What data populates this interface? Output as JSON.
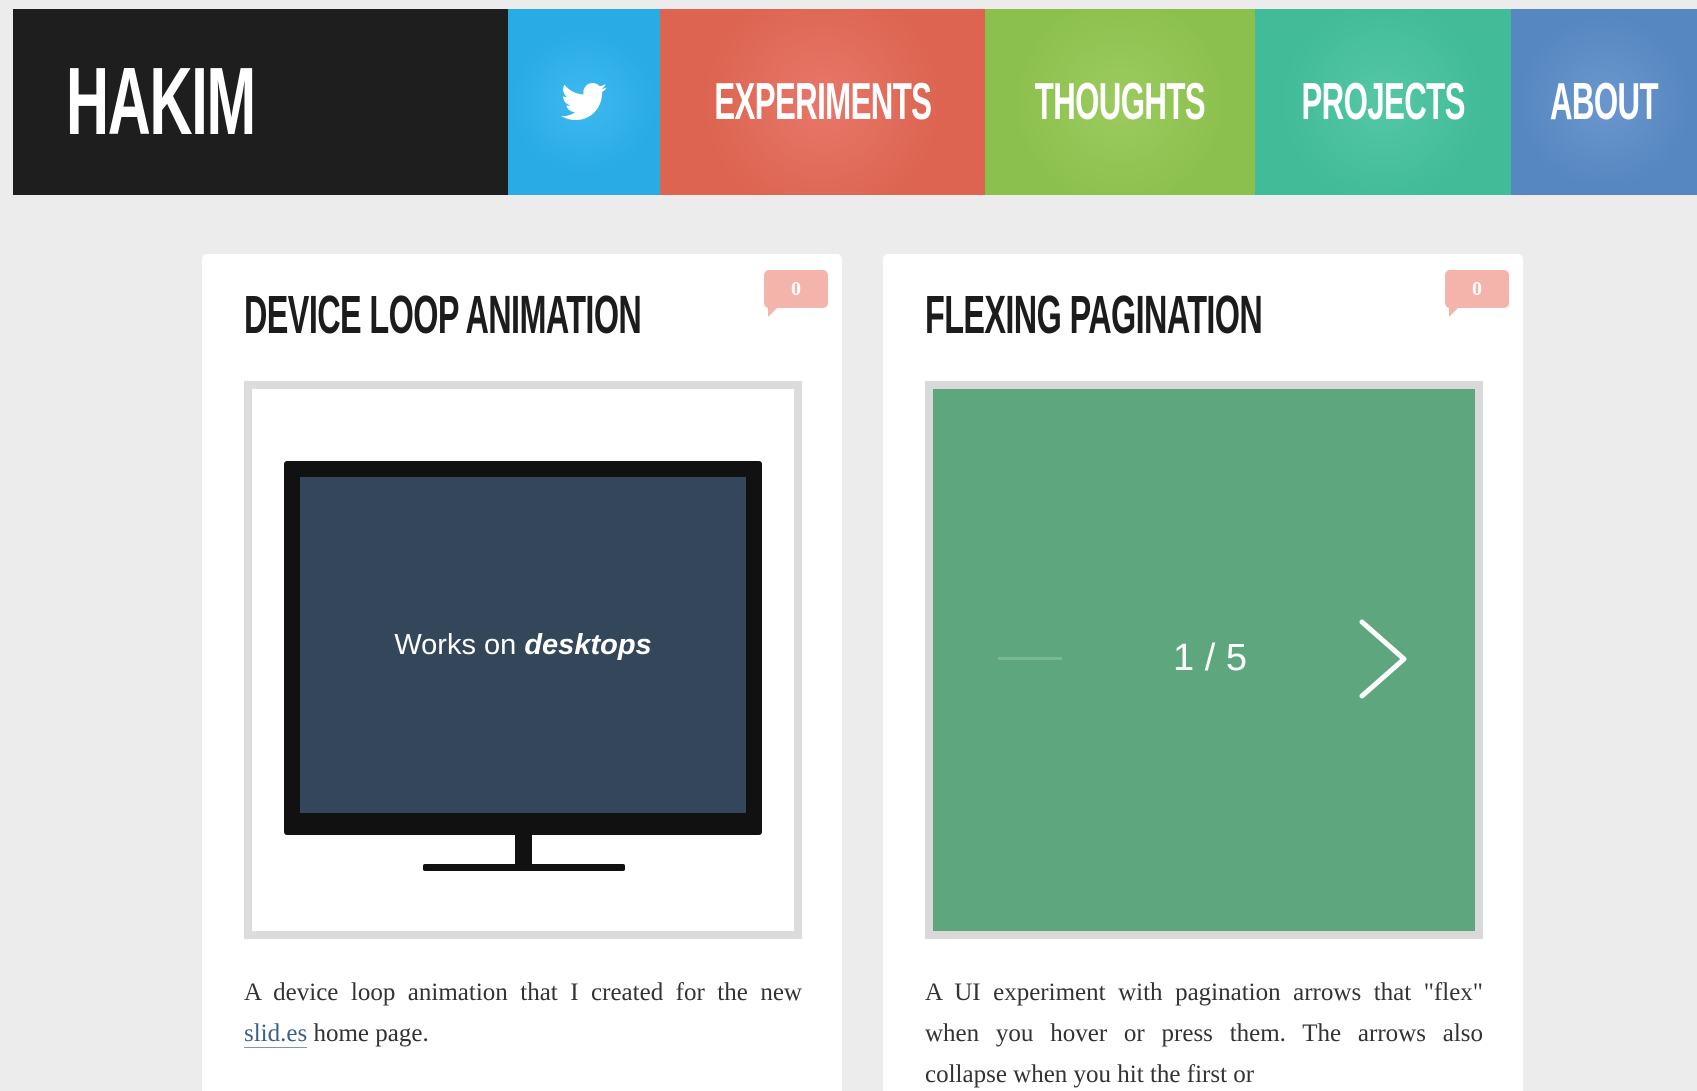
{
  "header": {
    "logo": "HAKIM",
    "nav": [
      {
        "label": "",
        "icon": "twitter-icon",
        "color": "#29abe6"
      },
      {
        "label": "EXPERIMENTS",
        "color": "#e0634f"
      },
      {
        "label": "THOUGHTS",
        "color": "#8ec14f"
      },
      {
        "label": "PROJECTS",
        "color": "#43bc9a"
      },
      {
        "label": "ABOUT",
        "color": "#5a88c2"
      }
    ]
  },
  "cards": [
    {
      "title": "DEVICE LOOP ANIMATION",
      "comments": "0",
      "preview_text": "Works on",
      "preview_text_emphasis": "desktops",
      "description_before": "A device loop animation that I created for the new",
      "description_link": "slid.es",
      "description_after": "home page."
    },
    {
      "title": "FLEXING PAGINATION",
      "comments": "0",
      "pager": "1 / 5",
      "preview_color": "#5ea67e",
      "description": "A UI experiment with pagination arrows that \"flex\" when you hover or press them. The arrows also collapse when you hit the first or"
    }
  ]
}
